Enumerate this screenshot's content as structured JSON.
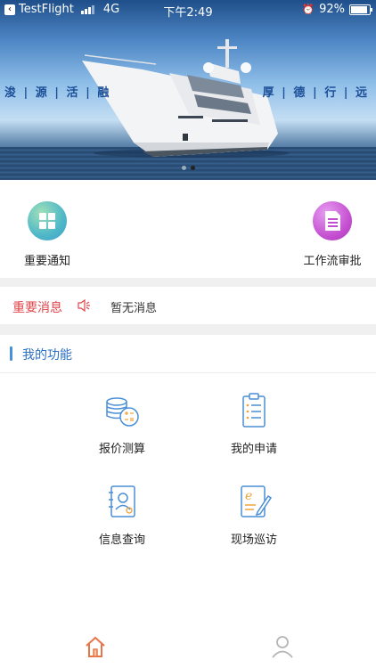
{
  "status_bar": {
    "back_app": "TestFlight",
    "network": "4G",
    "time": "下午2:49",
    "battery": "92%"
  },
  "banner": {
    "slogan_left": "浚 | 源 | 活 | 融",
    "slogan_right": "厚 | 德 | 行 | 远",
    "slides_total": 2,
    "active_slide": 1
  },
  "quick_entries": [
    {
      "label": "重要通知",
      "icon": "grid-icon",
      "color": "#4fb7c9"
    },
    {
      "label": "工作流审批",
      "icon": "document-icon",
      "color": "#c34dcf"
    }
  ],
  "notice": {
    "title": "重要消息",
    "text": "暂无消息",
    "icon": "speaker-icon"
  },
  "functions": {
    "title": "我的功能",
    "items": [
      {
        "label": "报价测算",
        "icon": "coins-calculator-icon"
      },
      {
        "label": "我的申请",
        "icon": "clipboard-icon"
      },
      {
        "label": "信息查询",
        "icon": "contact-book-icon"
      },
      {
        "label": "现场巡访",
        "icon": "notebook-pen-icon"
      }
    ]
  },
  "tabbar": {
    "items": [
      {
        "name": "home",
        "icon": "home-icon",
        "active": true
      },
      {
        "name": "profile",
        "icon": "user-icon",
        "active": false
      }
    ]
  },
  "colors": {
    "accent_blue": "#2a6fc0",
    "notice_red": "#e0454a",
    "tab_active": "#e8754a",
    "tab_inactive": "#b5b5b5"
  }
}
